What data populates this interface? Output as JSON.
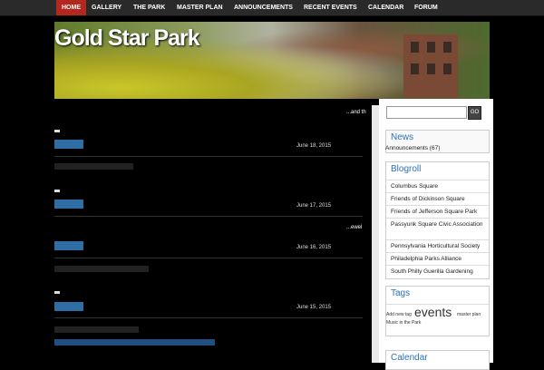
{
  "nav": {
    "items": [
      "HOME",
      "GALLERY",
      "THE PARK",
      "MASTER PLAN",
      "ANNOUNCEMENTS",
      "RECENT EVENTS",
      "CALENDAR",
      "FORUM"
    ]
  },
  "header": {
    "site_title": "Gold Star Park"
  },
  "posts": {
    "snippet1": "...and th",
    "date1": "June 18, 2015",
    "date2": "June 17, 2015",
    "date3": "June 16, 2015",
    "date4": "June 15, 2015",
    "snippet2": "...ewel"
  },
  "sidebar": {
    "search": {
      "button_label": "GO"
    },
    "news": {
      "title": "News",
      "category": "Announcements",
      "count": "(67)"
    },
    "blogroll": {
      "title": "Blogroll",
      "links": [
        "Columbus Square",
        "Friends of Dickinson Square",
        "Friends of Jefferson Square Park",
        "Passyunk Square Civic Association",
        "Pennsylvania Horticultural Society",
        "Philadelphia Parks Alliance",
        "South Philly Guerilla Gardening"
      ]
    },
    "tags": {
      "title": "Tags",
      "items": [
        "Add new tag",
        "events",
        "master plan",
        "Music in the Park"
      ]
    },
    "calendar": {
      "title": "Calendar"
    }
  }
}
